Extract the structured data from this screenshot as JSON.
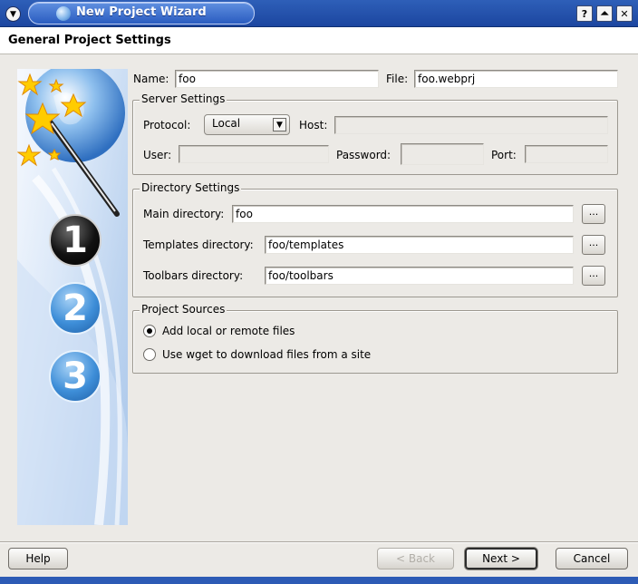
{
  "window": {
    "title": "New Project Wizard",
    "buttons": {
      "help": "?",
      "shade": "⏶",
      "close": "✕"
    }
  },
  "header": {
    "title": "General Project Settings"
  },
  "general": {
    "name_label": "Name:",
    "name_value": "foo",
    "file_label": "File:",
    "file_value": "foo.webprj"
  },
  "server": {
    "title": "Server Settings",
    "protocol_label": "Protocol:",
    "protocol_value": "Local",
    "host_label": "Host:",
    "host_value": "",
    "user_label": "User:",
    "user_value": "",
    "password_label": "Password:",
    "password_value": "",
    "port_label": "Port:",
    "port_value": ""
  },
  "directories": {
    "title": "Directory Settings",
    "main_label": "Main directory:",
    "main_value": "foo",
    "templates_label": "Templates directory:",
    "templates_value": "foo/templates",
    "toolbars_label": "Toolbars directory:",
    "toolbars_value": "foo/toolbars",
    "browse_label": "..."
  },
  "sources": {
    "title": "Project Sources",
    "option_local": "Add local or remote files",
    "option_wget": "Use wget to download files from a site",
    "selected": "option_local"
  },
  "steps": [
    "1",
    "2",
    "3"
  ],
  "footer": {
    "help": "Help",
    "back": "< Back",
    "next": "Next >",
    "cancel": "Cancel"
  }
}
